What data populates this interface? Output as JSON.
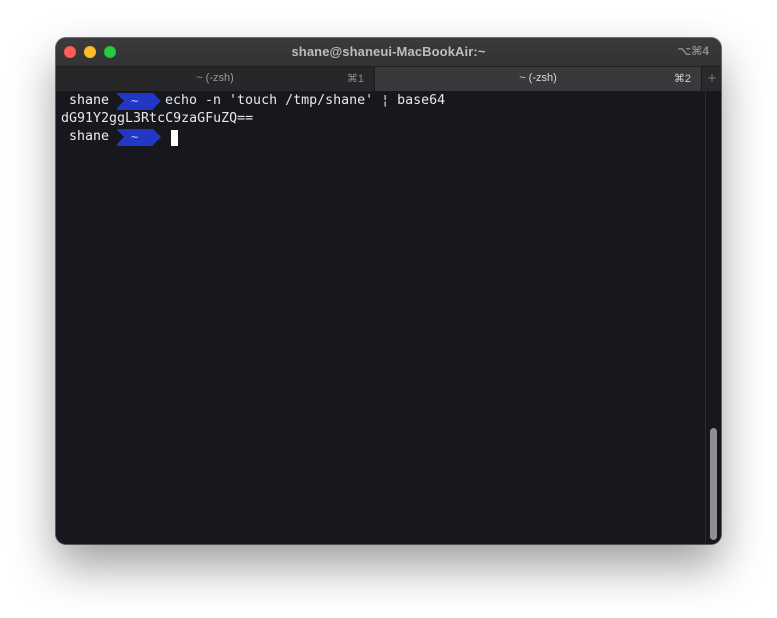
{
  "window": {
    "title": "shane@shaneui-MacBookAir:~",
    "shortcut": "⌥⌘4"
  },
  "tabs": [
    {
      "label": "~ (-zsh)",
      "shortcut": "⌘1",
      "active": false
    },
    {
      "label": "~ (-zsh)",
      "shortcut": "⌘2",
      "active": true
    }
  ],
  "new_tab_icon": "+",
  "terminal": {
    "lines": [
      {
        "user": "shane",
        "dir": "~",
        "command": "echo -n 'touch /tmp/shane' ¦ base64"
      },
      {
        "output": "dG91Y2ggL3RtcC9zaGFuZQ=="
      },
      {
        "user": "shane",
        "dir": "~",
        "command": ""
      }
    ]
  },
  "colors": {
    "background": "#16181d",
    "prompt_dir_bg": "#2237c6",
    "close": "#fe5f57",
    "minimize": "#febc2e",
    "maximize": "#28c840"
  }
}
